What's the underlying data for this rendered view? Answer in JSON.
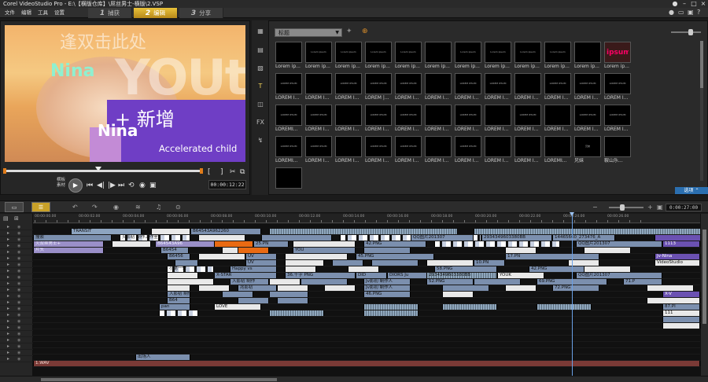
{
  "window": {
    "title": "Corel VideoStudio Pro - E:\\【横版仓库】\\屌丝男士-横版\\2.VSP"
  },
  "menu": [
    "文件",
    "编辑",
    "工具",
    "设置"
  ],
  "steps": [
    {
      "num": "1",
      "label": "捕获"
    },
    {
      "num": "2",
      "label": "编辑"
    },
    {
      "num": "3",
      "label": "分享"
    }
  ],
  "preview": {
    "overlay_texts": {
      "top": "逢双击此处",
      "nina1": "Nina",
      "youth": "YOUth",
      "add": "+ 新增",
      "nina2": "Nina",
      "accel": "Accelerated child"
    },
    "mode_label_1": "横板",
    "mode_label_2": "素材",
    "timecode": "00:00:12:22"
  },
  "library": {
    "folder": "标题",
    "option_button": "选项",
    "thumb_caption_rows": [
      [
        "Lorem ip...",
        "Lorem ip...",
        "Lorem ip...",
        "Lorem ip...",
        "Lorem ip...",
        "Lorem ip...",
        "Lorem ip...",
        "Lorem ip...",
        "Lorem ip...",
        "Lorem ip...",
        "Lorem ip...",
        "Lorem ip..."
      ],
      [
        "LOREM I...",
        "LOREM I...",
        "LOREM I...",
        "LOREM |...",
        "LOREM I...",
        "LOREM I...",
        "LOREM I...",
        "LOREM I...",
        "LOREM I...",
        "LOREM I...",
        "LOREM I...",
        "LOREM I..."
      ],
      [
        "LOREMI...",
        "LOREM I...",
        "LOREM I...",
        "LOREM I...",
        "LOREM I...",
        "LOREM I...",
        "LOREM I...",
        "LOREM I...",
        "LOREM I...",
        "LOREM I...",
        "LOREM I...",
        "LOREM I..."
      ],
      [
        "LOREMI...",
        "LOREM I...",
        "LOREM I...",
        "LOREM I...",
        "LOREM I...",
        "LOREM I...",
        "LOREM I...",
        "LOREM I...",
        "LOREM I...",
        "LOREMI...",
        "兄妹",
        "鞍山乐..."
      ],
      [
        ""
      ]
    ],
    "thumb_inner_rows": [
      [
        "",
        "Lorem ipsum",
        "Lorem ipsum",
        "Lorem ipsum",
        "Lorem ipsum",
        "",
        "Lorem ipsum",
        "Lorem ipsum",
        "Lorem ipsum",
        "Lorem ipsum",
        "",
        "ipsum"
      ],
      [
        "LOREM IPSUM",
        "",
        "LOREM IPSUM",
        "LOREM IPSUM",
        "LOREM IPSUM",
        "",
        "LOREM IPSUM",
        "LOREM IPSUM",
        "",
        "LOREM IPSUM",
        "LOREM IPSUM",
        "LOREM IPSUM"
      ],
      [
        "LOREM IPSUM",
        "LOREM IPSUM",
        "",
        "LOREM IPSUM",
        "LOREM IPSUM",
        "",
        "LOREM IPSUM",
        "",
        "LOREM IPSUM",
        "",
        "LOREM IPSUM",
        "LOREM IPSUM"
      ],
      [
        "LOREM IPSUM",
        "LOREM IPSUM",
        "",
        "LOREM IPSUM",
        "LOREM IPSUM",
        "",
        "LOREM IPSUM",
        "",
        "",
        "",
        "兄妹",
        ""
      ],
      [
        ""
      ]
    ]
  },
  "timeline": {
    "timecode": "0:00:27:00",
    "ruler_labels": [
      "00:00:00.00",
      "00:00:02.00",
      "00:00:04.00",
      "00:00:06.00",
      "00:00:08.00",
      "00:00:10.00",
      "00:00:12.00",
      "00:00:14.00",
      "00:00:16.00",
      "00:00:18.00",
      "00:00:20.00",
      "00:00:22.00",
      "00:00:24.00",
      "00:00:26.00"
    ],
    "clip_labels": {
      "transit": "TRANSIT",
      "b64543": "B64543A962260",
      "youke": "搜索",
      "zhizuo": "火影初 制作工作室",
      "b64543b": "B64543A96",
      "c25png": "25.PN",
      "qq1": "QQ图片201307",
      "qq2": "QQ图片201307",
      "eeecn": "3EEECN_20130",
      "n2934": "2934349603380BB",
      "n1446": "14465660_273476_A",
      "qq3": "QQ图片201307",
      "ninaname": "火双丝男士+",
      "n42png": "42.PNG",
      "n69png": "69.PNG",
      "n1113": "1113",
      "jiantou": "片头",
      "b6454": "B6454",
      "uv": "UV",
      "you": "YOU",
      "n45png": "45.PNG",
      "n17png": "17.PN",
      "jvnina": "Jv-Nina",
      "b6456": "B6456",
      "uv2": "UV",
      "n10png": "10.PN",
      "vs": "VideoStudio",
      "xiadaibei": "小第一举",
      "happy": "Happy vs",
      "n58png": "58.PNG",
      "n42png2": "42.PNG",
      "xstar": "X-STAR",
      "n36png": "36.千字 PNG",
      "did": "DID",
      "diors": "DIORS Ju",
      "n2934b": "2934349603380BB",
      "youk": "YOUK",
      "qqlast": "QQ图片201307",
      "ru": "入影初 制作",
      "n32png": "32.PNG",
      "jvmake": "Jv影初 制作人",
      "n52png": "52.PNG",
      "n69b": "69.PNG",
      "n71p": "71.P",
      "zhaoqi": "兆影初",
      "xiaoshenji": "入影初 制作工",
      "jv2": "Jv影初 制作人",
      "n46png": "46.PNG",
      "n72png": "72.PNG",
      "xv": "X-V",
      "b64": "B64",
      "love": "LOVE",
      "n87": "87.PI",
      "pan": "pan",
      "n11": "111",
      "chunlin": "出场人",
      "wav": "1.WAV"
    }
  },
  "colors": {
    "accent_yellow": "#e9c23a",
    "clip_blue": "#7b8fae",
    "clip_purple": "#9a8fc8",
    "marker_green": "#6dbb3c",
    "playhead": "#6aa0e6",
    "audio_red": "#7a3a36"
  }
}
